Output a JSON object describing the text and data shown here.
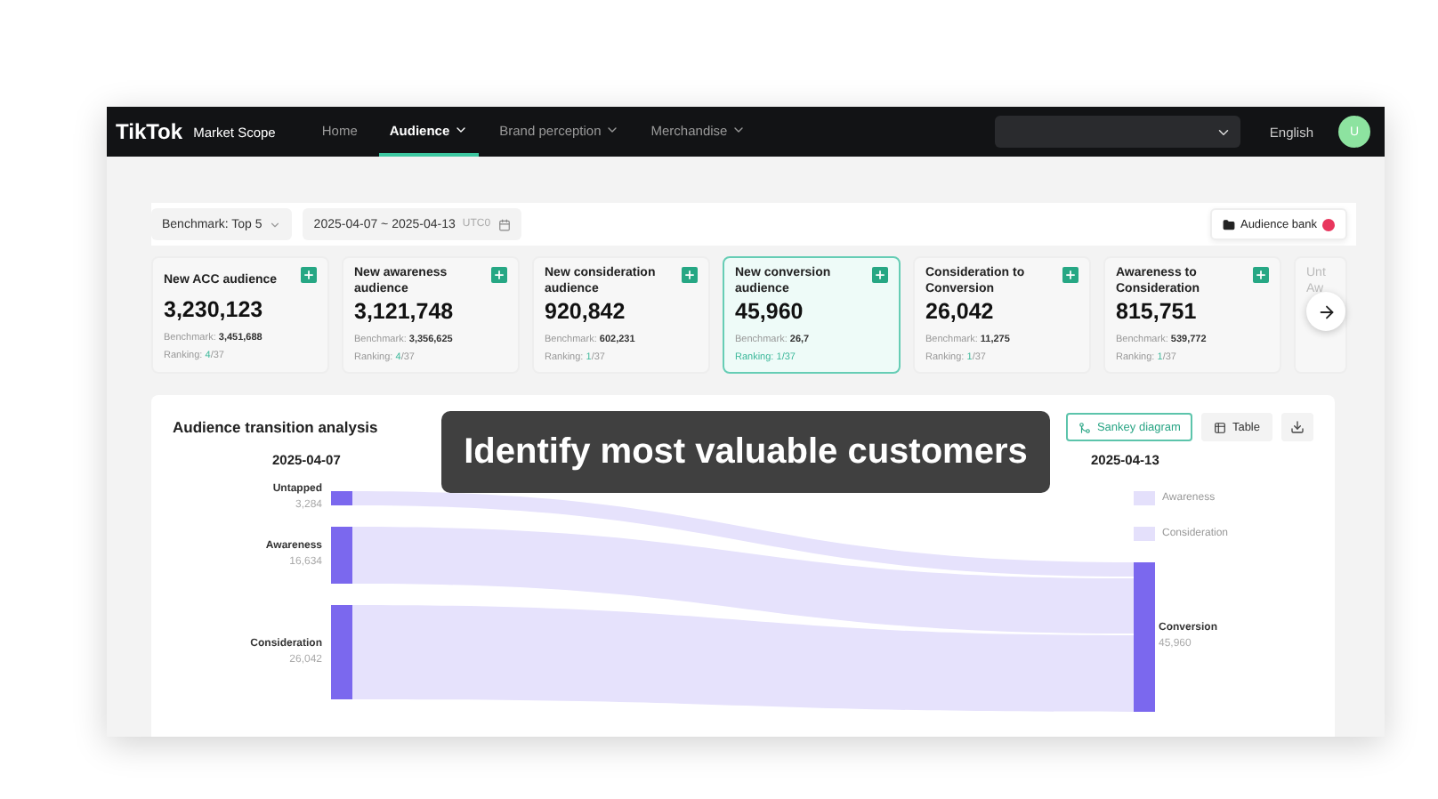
{
  "navbar": {
    "logo": "TikTok",
    "product": "Market Scope",
    "items": [
      {
        "label": "Home",
        "selected": false,
        "dropdown": false
      },
      {
        "label": "Audience",
        "selected": true,
        "dropdown": true
      },
      {
        "label": "Brand perception",
        "selected": false,
        "dropdown": true
      },
      {
        "label": "Merchandise",
        "selected": false,
        "dropdown": true
      }
    ],
    "language": "English",
    "avatar": "U"
  },
  "filters": {
    "benchmark": "Benchmark: Top 5",
    "date_range": "2025-04-07 ~ 2025-04-13",
    "timezone": "UTC0",
    "audience_bank": "Audience bank"
  },
  "cards": [
    {
      "title": "New ACC audience",
      "value": "3,230,123",
      "benchmark_label": "Benchmark:",
      "benchmark": "3,451,688",
      "ranking_label": "Ranking:",
      "rank": "4",
      "total": "/37",
      "selected": false
    },
    {
      "title": "New awareness audience",
      "value": "3,121,748",
      "benchmark_label": "Benchmark:",
      "benchmark": "3,356,625",
      "ranking_label": "Ranking:",
      "rank": "4",
      "total": "/37",
      "selected": false
    },
    {
      "title": "New consideration audience",
      "value": "920,842",
      "benchmark_label": "Benchmark:",
      "benchmark": "602,231",
      "ranking_label": "Ranking:",
      "rank": "1",
      "total": "/37",
      "selected": false
    },
    {
      "title": "New conversion audience",
      "value": "45,960",
      "benchmark_label": "Benchmark:",
      "benchmark": "26,7",
      "ranking_label": "Ranking:",
      "rank": "1",
      "total": "/37",
      "selected": true
    },
    {
      "title": "Consideration to Conversion",
      "value": "26,042",
      "benchmark_label": "Benchmark:",
      "benchmark": "11,275",
      "ranking_label": "Ranking:",
      "rank": "1",
      "total": "/37",
      "selected": false
    },
    {
      "title": "Awareness to Consideration",
      "value": "815,751",
      "benchmark_label": "Benchmark:",
      "benchmark": "539,772",
      "ranking_label": "Ranking:",
      "rank": "1",
      "total": "/37",
      "selected": false
    },
    {
      "title": "Unt Aw",
      "partial": true,
      "selected": false
    }
  ],
  "analysis": {
    "title": "Audience transition analysis",
    "views": [
      {
        "label": "Sankey diagram",
        "selected": true
      },
      {
        "label": "Table",
        "selected": false
      }
    ],
    "start_date": "2025-04-07",
    "end_date": "2025-04-13",
    "left_nodes": [
      {
        "name": "Untapped",
        "value": "3,284"
      },
      {
        "name": "Awareness",
        "value": "16,634"
      },
      {
        "name": "Consideration",
        "value": "26,042"
      }
    ],
    "right_nodes": [
      {
        "name": "Conversion",
        "value": "45,960"
      }
    ],
    "legend": [
      "Awareness",
      "Consideration"
    ]
  },
  "caption": "Identify most valuable customers"
}
